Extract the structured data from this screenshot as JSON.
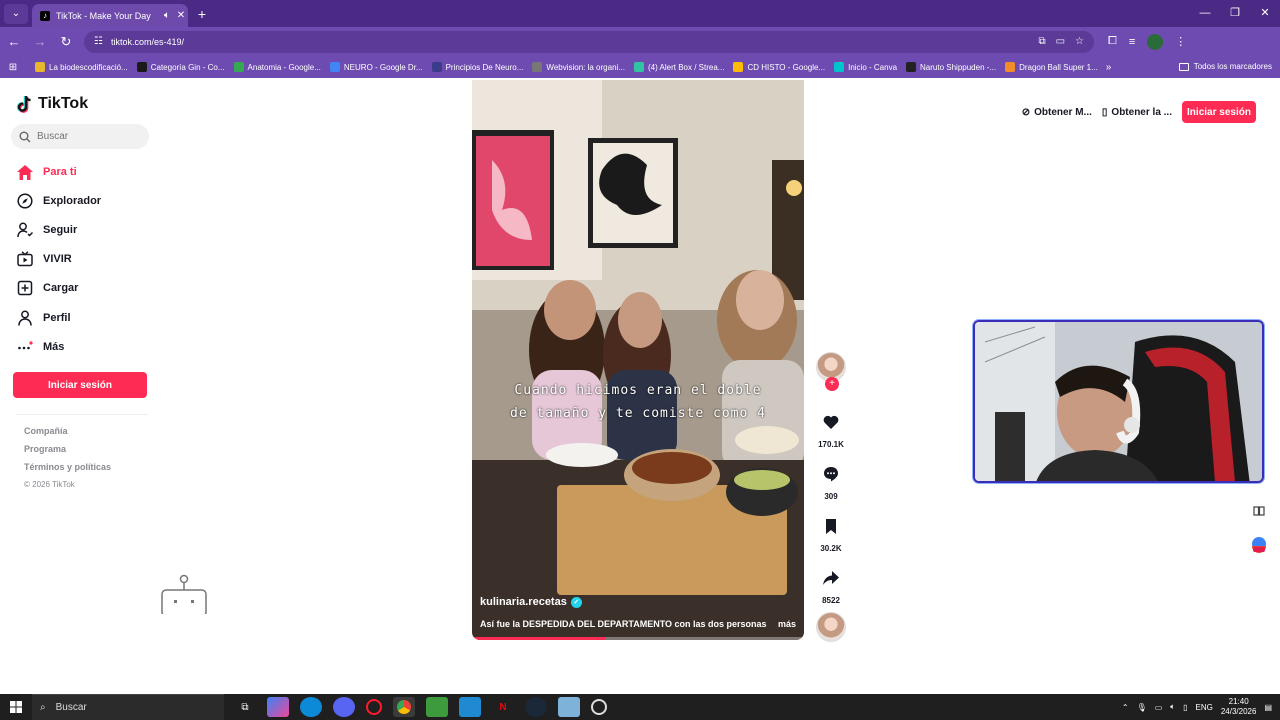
{
  "browser": {
    "tab_title": "TikTok - Make Your Day",
    "url": "tiktok.com/es-419/",
    "bookmarks": [
      {
        "label": "La biodescodificació...",
        "color": "#e8b62c"
      },
      {
        "label": "Categoría Gin - Co...",
        "color": "#1a1a1a"
      },
      {
        "label": "Anatomia - Google...",
        "color": "#34a853"
      },
      {
        "label": "NEURO - Google Dr...",
        "color": "#4285f4"
      },
      {
        "label": "Principios De Neuro...",
        "color": "#3c3c8c"
      },
      {
        "label": "Webvision: la organi...",
        "color": "#777777"
      },
      {
        "label": "(4) Alert Box / Strea...",
        "color": "#31c3a2"
      },
      {
        "label": "CD HISTO - Google...",
        "color": "#fbbc05"
      },
      {
        "label": "Inicio - Canva",
        "color": "#00c4cc"
      },
      {
        "label": "Naruto Shippuden -...",
        "color": "#222222"
      },
      {
        "label": "Dragon Ball Super 1...",
        "color": "#f28c28"
      }
    ],
    "bookmarks_all": "Todos los marcadores"
  },
  "sidebar": {
    "brand": "TikTok",
    "search_placeholder": "Buscar",
    "nav": [
      {
        "label": "Para ti",
        "icon": "home-icon"
      },
      {
        "label": "Explorador",
        "icon": "compass-icon"
      },
      {
        "label": "Seguir",
        "icon": "follow-user-icon"
      },
      {
        "label": "VIVIR",
        "icon": "live-tv-icon"
      },
      {
        "label": "Cargar",
        "icon": "upload-plus-icon"
      },
      {
        "label": "Perfil",
        "icon": "profile-icon"
      },
      {
        "label": "Más",
        "icon": "more-dots-icon"
      }
    ],
    "login_button": "Iniciar sesión",
    "footer_links": [
      "Compañía",
      "Programa",
      "Términos y políticas"
    ],
    "copyright": "© 2026 TikTok"
  },
  "video": {
    "caption_line1": "Cuando hicimos eran el doble",
    "caption_line2": "de tamaño y te comiste como 4",
    "author": "kulinaria.recetas",
    "description": "Así fue la DESPEDIDA DEL DEPARTAMENTO con las dos personas",
    "more_label": "más",
    "progress": 0.4
  },
  "actions": {
    "likes": "170.1K",
    "comments": "309",
    "saves": "30.2K",
    "shares": "8522"
  },
  "topright": {
    "get_coins": "Obtener M...",
    "get_app": "Obtener la ...",
    "login": "Iniciar sesión"
  },
  "taskbar": {
    "search_label": "Buscar",
    "language": "ENG",
    "time": "21:40",
    "date": "24/3/2026"
  },
  "colors": {
    "accent": "#fe2c55",
    "chrome": "#6e4bb0"
  }
}
